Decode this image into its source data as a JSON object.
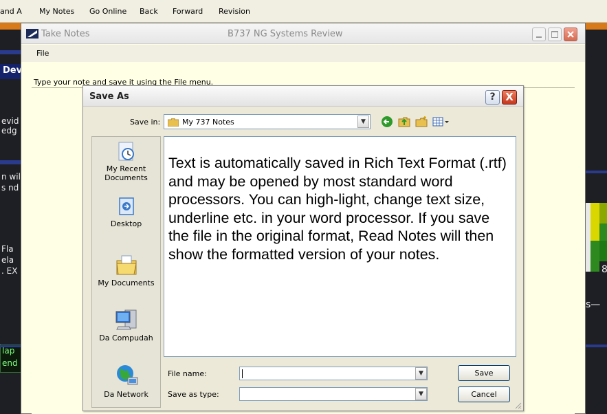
{
  "app_menu": [
    "and A",
    "My Notes",
    "Go Online",
    "Back",
    "Forward",
    "Revision"
  ],
  "background_left": [
    "Dev",
    "evid",
    "edg",
    "n wil",
    "s nd",
    "Fla",
    "ela",
    ". EX",
    "lap",
    "end"
  ],
  "background_right": [
    "8",
    "s—"
  ],
  "take_notes": {
    "title": "Take Notes",
    "center_title": "B737 NG Systems Review",
    "menu_file": "File",
    "instruction": "Type your note and save it using the File menu."
  },
  "save_as": {
    "title": "Save As",
    "help_label": "?",
    "close_label": "X",
    "save_in_label": "Save in:",
    "save_in_value": "My 737 Notes",
    "places": [
      {
        "label": "My Recent Documents",
        "icon": "recent-documents-icon"
      },
      {
        "label": "Desktop",
        "icon": "desktop-icon"
      },
      {
        "label": "My Documents",
        "icon": "my-documents-icon"
      },
      {
        "label": "Da Compudah",
        "icon": "my-computer-icon"
      },
      {
        "label": "Da Network",
        "icon": "network-icon"
      }
    ],
    "message": "Text is automatically saved in Rich Text Format (.rtf) and may be opened by most standard word processors. You can high-light, change text size, underline etc. in your word processor. If you save the file in the original format, Read Notes will then show the formatted version of your notes.",
    "file_name_label": "File name:",
    "file_name_value": "",
    "save_as_type_label": "Save as type:",
    "save_as_type_value": "",
    "save_button": "Save",
    "cancel_button": "Cancel"
  },
  "colors": {
    "dialog_face": "#ece9d8",
    "notes_background": "#ffffe6",
    "close_red": "#c3371e",
    "orange_stripe": "#d87a1a"
  }
}
